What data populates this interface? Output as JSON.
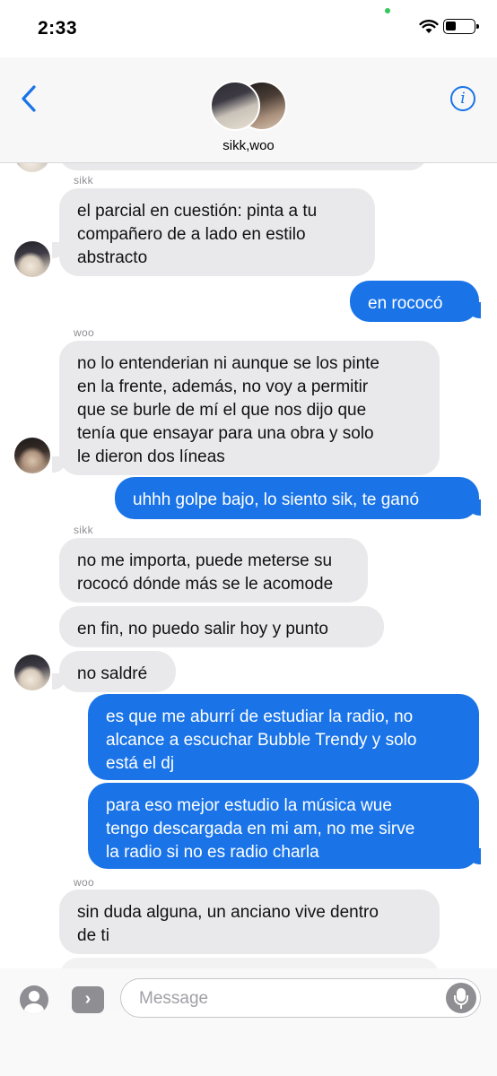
{
  "status_bar": {
    "time": "2:33"
  },
  "header": {
    "title": "sikk,woo",
    "info_label": "i"
  },
  "messages": [
    {
      "sender": "sikk",
      "text": "el parcial en cuestión: pinta a tu\ncompañero de a lado en estilo\nabstracto"
    },
    {
      "text": "en rococó"
    },
    {
      "sender": "woo",
      "text": "no lo entenderian ni aunque se los pinte\nen la frente, además, no voy a permitir\nque se burle de mí el que nos dijo que\ntenía que ensayar para una obra y solo\nle dieron dos líneas"
    },
    {
      "text": "uhhh golpe bajo, lo siento sik, te ganó"
    },
    {
      "sender": "sikk",
      "text": "no me importa, puede meterse su\nrococó dónde más se le acomode"
    },
    {
      "text": "en fin, no puedo salir hoy y punto"
    },
    {
      "text": "no saldré"
    },
    {
      "text": "es que me aburrí de estudiar la radio, no\nalcance a escuchar Bubble Trendy y solo\nestá el dj"
    },
    {
      "text": "para eso mejor estudio la música wue\ntengo descargada en mi am, no me sirve\nla radio si no es radio charla"
    },
    {
      "sender": "woo",
      "text": "sin duda alguna, un anciano vive dentro\nde ti"
    }
  ],
  "input_bar": {
    "placeholder": "Message",
    "apps_label": "›"
  }
}
